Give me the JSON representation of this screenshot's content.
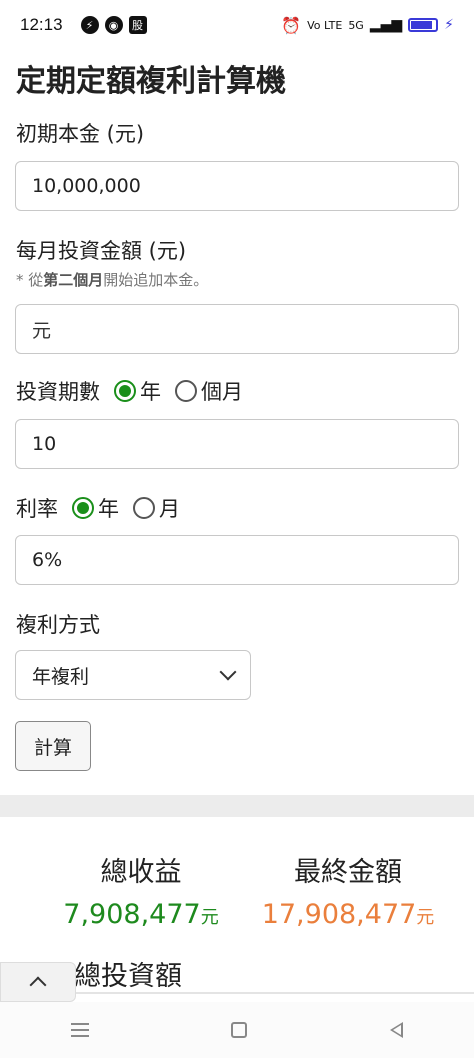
{
  "status": {
    "time": "12:13",
    "app_icons": [
      "messenger-icon",
      "chrome-icon",
      "stock-app-icon"
    ],
    "stock_app_glyph": "股",
    "network": "5G",
    "volte": "Vo LTE"
  },
  "page_title": "定期定額複利計算機",
  "principal": {
    "label": "初期本金 (元)",
    "value": "10,000,000"
  },
  "monthly": {
    "label": "每月投資金額 (元)",
    "hint_prefix": "* 從",
    "hint_bold": "第二個月",
    "hint_suffix": "開始追加本金。",
    "placeholder": "元"
  },
  "periods": {
    "label": "投資期數",
    "option_year": "年",
    "option_month": "個月",
    "selected": "年",
    "value": "10"
  },
  "rate": {
    "label": "利率",
    "option_year": "年",
    "option_month": "月",
    "selected": "年",
    "value": "6%"
  },
  "compound": {
    "label": "複利方式",
    "selected": "年複利"
  },
  "calculate_label": "計算",
  "results": {
    "total_gain_label": "總收益",
    "total_gain_value": "7,908,477",
    "final_amount_label": "最終金額",
    "final_amount_value": "17,908,477",
    "unit": "元",
    "total_invest_label": "總投資額"
  },
  "colors": {
    "accent_green": "#1e8a1e",
    "accent_orange": "#ea7f3c",
    "radio_selected": "#1a8f1a"
  }
}
